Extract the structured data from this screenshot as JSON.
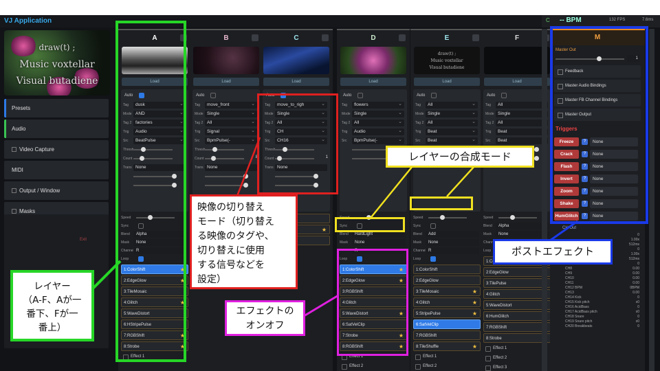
{
  "app": {
    "title": "VJ Application"
  },
  "bpm": {
    "c": "C",
    "label": "-- BPM",
    "fps": "132 FPS",
    "ms": "7.6ms"
  },
  "preview": {
    "lines": [
      "draw(t) ;",
      "Music voxtellar",
      "Visual butadiene"
    ]
  },
  "sidebar": {
    "items": [
      {
        "label": "Presets",
        "type": "pre"
      },
      {
        "label": "Audio",
        "type": "aud"
      },
      {
        "label": "Video Capture",
        "type": "cb"
      },
      {
        "label": "MIDI",
        "type": "plain"
      },
      {
        "label": "Output / Window",
        "type": "cb"
      },
      {
        "label": "Masks",
        "type": "cb"
      }
    ],
    "exit": "Exit"
  },
  "columns": [
    {
      "id": "A",
      "color": "#ffffff",
      "thumb": "bw",
      "load": "Load",
      "auto": "Auto",
      "rows": [
        [
          "Tag",
          "dusk"
        ],
        [
          "Mode",
          "AND"
        ],
        [
          "Tag 2",
          "factories"
        ],
        [
          "Trig",
          "Audio"
        ],
        [
          "Src",
          "BeatPulse"
        ]
      ],
      "thresh": "Thresh",
      "count": "Count",
      "count_val": "8",
      "trans": "Trans",
      "trans_val": "None",
      "blend": "Alpha",
      "mask": "None",
      "channel": "R",
      "speed": "Speed",
      "sync": "Sync",
      "loop": "Loop",
      "blend_label": "Blend",
      "mask_label": "Mask",
      "channel_label": "Channel",
      "fx": [
        {
          "t": "1:ColorShift",
          "on": true,
          "star": true
        },
        {
          "t": "2:EdgeGlow",
          "on": false,
          "star": true
        },
        {
          "t": "3:TileMosaic",
          "on": false,
          "star": false
        },
        {
          "t": "4:Glitch",
          "on": false,
          "star": true
        },
        {
          "t": "5:WaveDistort",
          "on": false,
          "star": false
        },
        {
          "t": "6:HStripePulse",
          "on": false,
          "star": false
        },
        {
          "t": "7:RGBShift",
          "on": false,
          "star": true
        },
        {
          "t": "8:Strobe",
          "on": false,
          "star": true
        }
      ],
      "effects": [
        "Effect 1"
      ]
    },
    {
      "id": "B",
      "color": "#e6b6cc",
      "thumb": "dark",
      "load": "Load",
      "auto": "Auto",
      "rows": [
        [
          "Tag",
          "move_front"
        ],
        [
          "Mode",
          "Single"
        ],
        [
          "Tag 2",
          "All"
        ],
        [
          "Trig",
          "Signal"
        ],
        [
          "Src",
          "BpmPulse(-"
        ]
      ],
      "thresh": "Thresh",
      "count": "Count",
      "count_val": "8",
      "trans": "Trans",
      "trans_val": "None",
      "fx": [
        {
          "t": "4:Glitch",
          "on": false,
          "star": false
        },
        {
          "t": "5:WaveDistort",
          "on": false,
          "star": false
        },
        {
          "t": "6:HueShift",
          "on": false,
          "star": false
        },
        {
          "t": "7:RGBShift",
          "on": false,
          "star": false
        },
        {
          "t": "8:Strobe",
          "on": false,
          "star": false
        }
      ],
      "effects": [
        "Effect 1",
        "Effect 2"
      ]
    },
    {
      "id": "C",
      "color": "#9fe6ee",
      "thumb": "blue",
      "load": "Load",
      "auto": "Auto",
      "rows": [
        [
          "Tag",
          "move_to_righ"
        ],
        [
          "Mode",
          "Single"
        ],
        [
          "Tag 2",
          "All"
        ],
        [
          "Trig",
          "CH"
        ],
        [
          "Src",
          "CH16"
        ]
      ],
      "thresh": "Thresh",
      "count": "Count",
      "count_val": "1",
      "trans": "Trans",
      "trans_val": "None",
      "fx": [
        {
          "t": "5:WaveDistort",
          "on": false,
          "star": false
        },
        {
          "t": "6:HumGlitch",
          "on": false,
          "star": true
        },
        {
          "t": "7:Pixelate",
          "on": false,
          "star": false
        }
      ],
      "effects": []
    },
    {
      "id": "D",
      "color": "#cdeccd",
      "thumb": "flower",
      "load": "Load",
      "auto": "Auto",
      "rows": [
        [
          "Tag",
          "flowers"
        ],
        [
          "Mode",
          "Single"
        ],
        [
          "Tag 2",
          "All"
        ],
        [
          "Trig",
          "Audio"
        ],
        [
          "Src",
          "BpmPulse(-"
        ]
      ],
      "blend": "HardLight",
      "mask": "None",
      "channel": "R",
      "speed": "Speed",
      "sync": "Sync",
      "blend_label": "Blend",
      "mask_label": "Mask",
      "loop": "Loop",
      "fx": [
        {
          "t": "1:ColorShift",
          "on": true,
          "star": true
        },
        {
          "t": "2:EdgeGlow",
          "on": false,
          "star": true
        },
        {
          "t": "3:RGBShift",
          "on": false,
          "star": false
        },
        {
          "t": "4:Glitch",
          "on": false,
          "star": false
        },
        {
          "t": "5:WaveDistort",
          "on": false,
          "star": true
        },
        {
          "t": "6:SatVelClip",
          "on": false,
          "star": false
        },
        {
          "t": "7:Strobe",
          "on": false,
          "star": true
        },
        {
          "t": "8:RGBShift",
          "on": false,
          "star": true
        }
      ],
      "effects": [
        "Effect 1",
        "Effect 2"
      ]
    },
    {
      "id": "E",
      "color": "#9fe6ee",
      "thumb": "text",
      "load": "Load",
      "auto": "Auto",
      "rows": [
        [
          "Tag",
          "All"
        ],
        [
          "Mode",
          "Single"
        ],
        [
          "Tag 2",
          "All"
        ],
        [
          "Trig",
          "Beat"
        ],
        [
          "Src",
          "Beat"
        ]
      ],
      "blend": "Add",
      "mask": "None",
      "channel": "R",
      "speed": "Speed",
      "sync": "Sync",
      "blend_label": "Blend",
      "mask_label": "Mask",
      "channel_label": "Channel",
      "loop": "Loop",
      "fx": [
        {
          "t": "1:ColorShift",
          "on": false,
          "star": false
        },
        {
          "t": "2:EdgeGlow",
          "on": false,
          "star": false
        },
        {
          "t": "3:TileMosaic",
          "on": false,
          "star": true
        },
        {
          "t": "4:Glitch",
          "on": false,
          "star": true
        },
        {
          "t": "5:StripePulse",
          "on": false,
          "star": true
        },
        {
          "t": "6:SatVelClip",
          "on": true,
          "star": false
        },
        {
          "t": "7:RGBShift",
          "on": false,
          "star": false
        },
        {
          "t": "8:TileShuffle",
          "on": false,
          "star": true
        }
      ],
      "effects": [
        "Effect 1",
        "Effect 2",
        "Effect 3",
        "Effect 4"
      ]
    },
    {
      "id": "F",
      "color": "#dddddd",
      "thumb": "black",
      "load": "Load",
      "auto": "Auto",
      "rows": [
        [
          "Tag",
          "All"
        ],
        [
          "Mode",
          "Single"
        ],
        [
          "Tag 2",
          "All"
        ],
        [
          "Trig",
          "Beat"
        ],
        [
          "Src",
          "Beat"
        ]
      ],
      "blend": "Alpha",
      "mask": "None",
      "channel": "R",
      "speed": "Speed",
      "blend_label": "Blend",
      "mask_label": "Mask",
      "channel_label": "Channel",
      "loop": "Loop",
      "fx": [
        {
          "t": "1:ColorShift",
          "on": false,
          "star": false
        },
        {
          "t": "2:EdgeGlow",
          "on": false,
          "star": false
        },
        {
          "t": "3:TilePulse",
          "on": false,
          "star": false
        },
        {
          "t": "4:Glitch",
          "on": false,
          "star": false
        },
        {
          "t": "5:WaveDistort",
          "on": false,
          "star": false
        },
        {
          "t": "6:HumGlitch",
          "on": false,
          "star": false
        },
        {
          "t": "7:RGBShift",
          "on": false,
          "star": false
        },
        {
          "t": "8:Strobe",
          "on": false,
          "star": false
        }
      ],
      "effects": [
        "Effect 1",
        "Effect 2",
        "Effect 3",
        "Effect 4"
      ]
    }
  ],
  "master": {
    "id": "M",
    "out": "Master Out",
    "out_val": "1",
    "items": [
      "Feedback",
      "Master Audio Bindings",
      "Master FB Channel Bindings",
      "Master Output"
    ],
    "triggers_label": "Triggers",
    "triggers": [
      {
        "n": "Freeze",
        "v": "None"
      },
      {
        "n": "Crack",
        "v": "None"
      },
      {
        "n": "Flash",
        "v": "None"
      },
      {
        "n": "Invert",
        "v": "None"
      },
      {
        "n": "Zoom",
        "v": "None"
      },
      {
        "n": "Shake",
        "v": "None"
      },
      {
        "n": "HumGlitch",
        "v": "None"
      }
    ],
    "chout": "CH Out",
    "channels": [
      [
        "",
        "0"
      ],
      [
        "",
        "1.00x"
      ],
      [
        "",
        "512ms"
      ],
      [
        "",
        "0"
      ],
      [
        "CH5 Ratio tonals",
        "1.00x"
      ],
      [
        "CH6 Grainsz tonals",
        "512ms"
      ],
      [
        "CH7 HOLD tonals",
        "0"
      ],
      [
        "CH8",
        "0.00"
      ],
      [
        "CH9",
        "0.00"
      ],
      [
        "CH10",
        "0.00"
      ],
      [
        "CH11",
        "0.00"
      ],
      [
        "CH12 BPM",
        "0BPM"
      ],
      [
        "CH13",
        "0.00"
      ],
      [
        "CH14 Kick",
        "0"
      ],
      [
        "CH15 Kick pitch",
        "x0"
      ],
      [
        "CH16 AcidBass",
        "0"
      ],
      [
        "CH17 AcidBass pitch",
        "x0"
      ],
      [
        "CH18 Snare",
        "0"
      ],
      [
        "CH19 Snare pitch",
        "x0"
      ],
      [
        "CH20 Breakbeats",
        "0"
      ]
    ]
  },
  "annotations": {
    "layer": "レイヤー（A-Fが、Aが一番下、Fが一番上）",
    "layer_lines": [
      "レイヤー",
      "（A-F、Aが一",
      "番下、Fが一",
      "番上）"
    ],
    "switch_lines": [
      "映像の切り替え",
      "モード（切り替え",
      "る映像のタグや、",
      "切り替えに使用",
      "する信号などを",
      "設定）"
    ],
    "blend": "レイヤーの合成モード",
    "fx_lines": [
      "エフェクトの",
      "オンオフ"
    ],
    "post": "ポストエフェクト"
  }
}
